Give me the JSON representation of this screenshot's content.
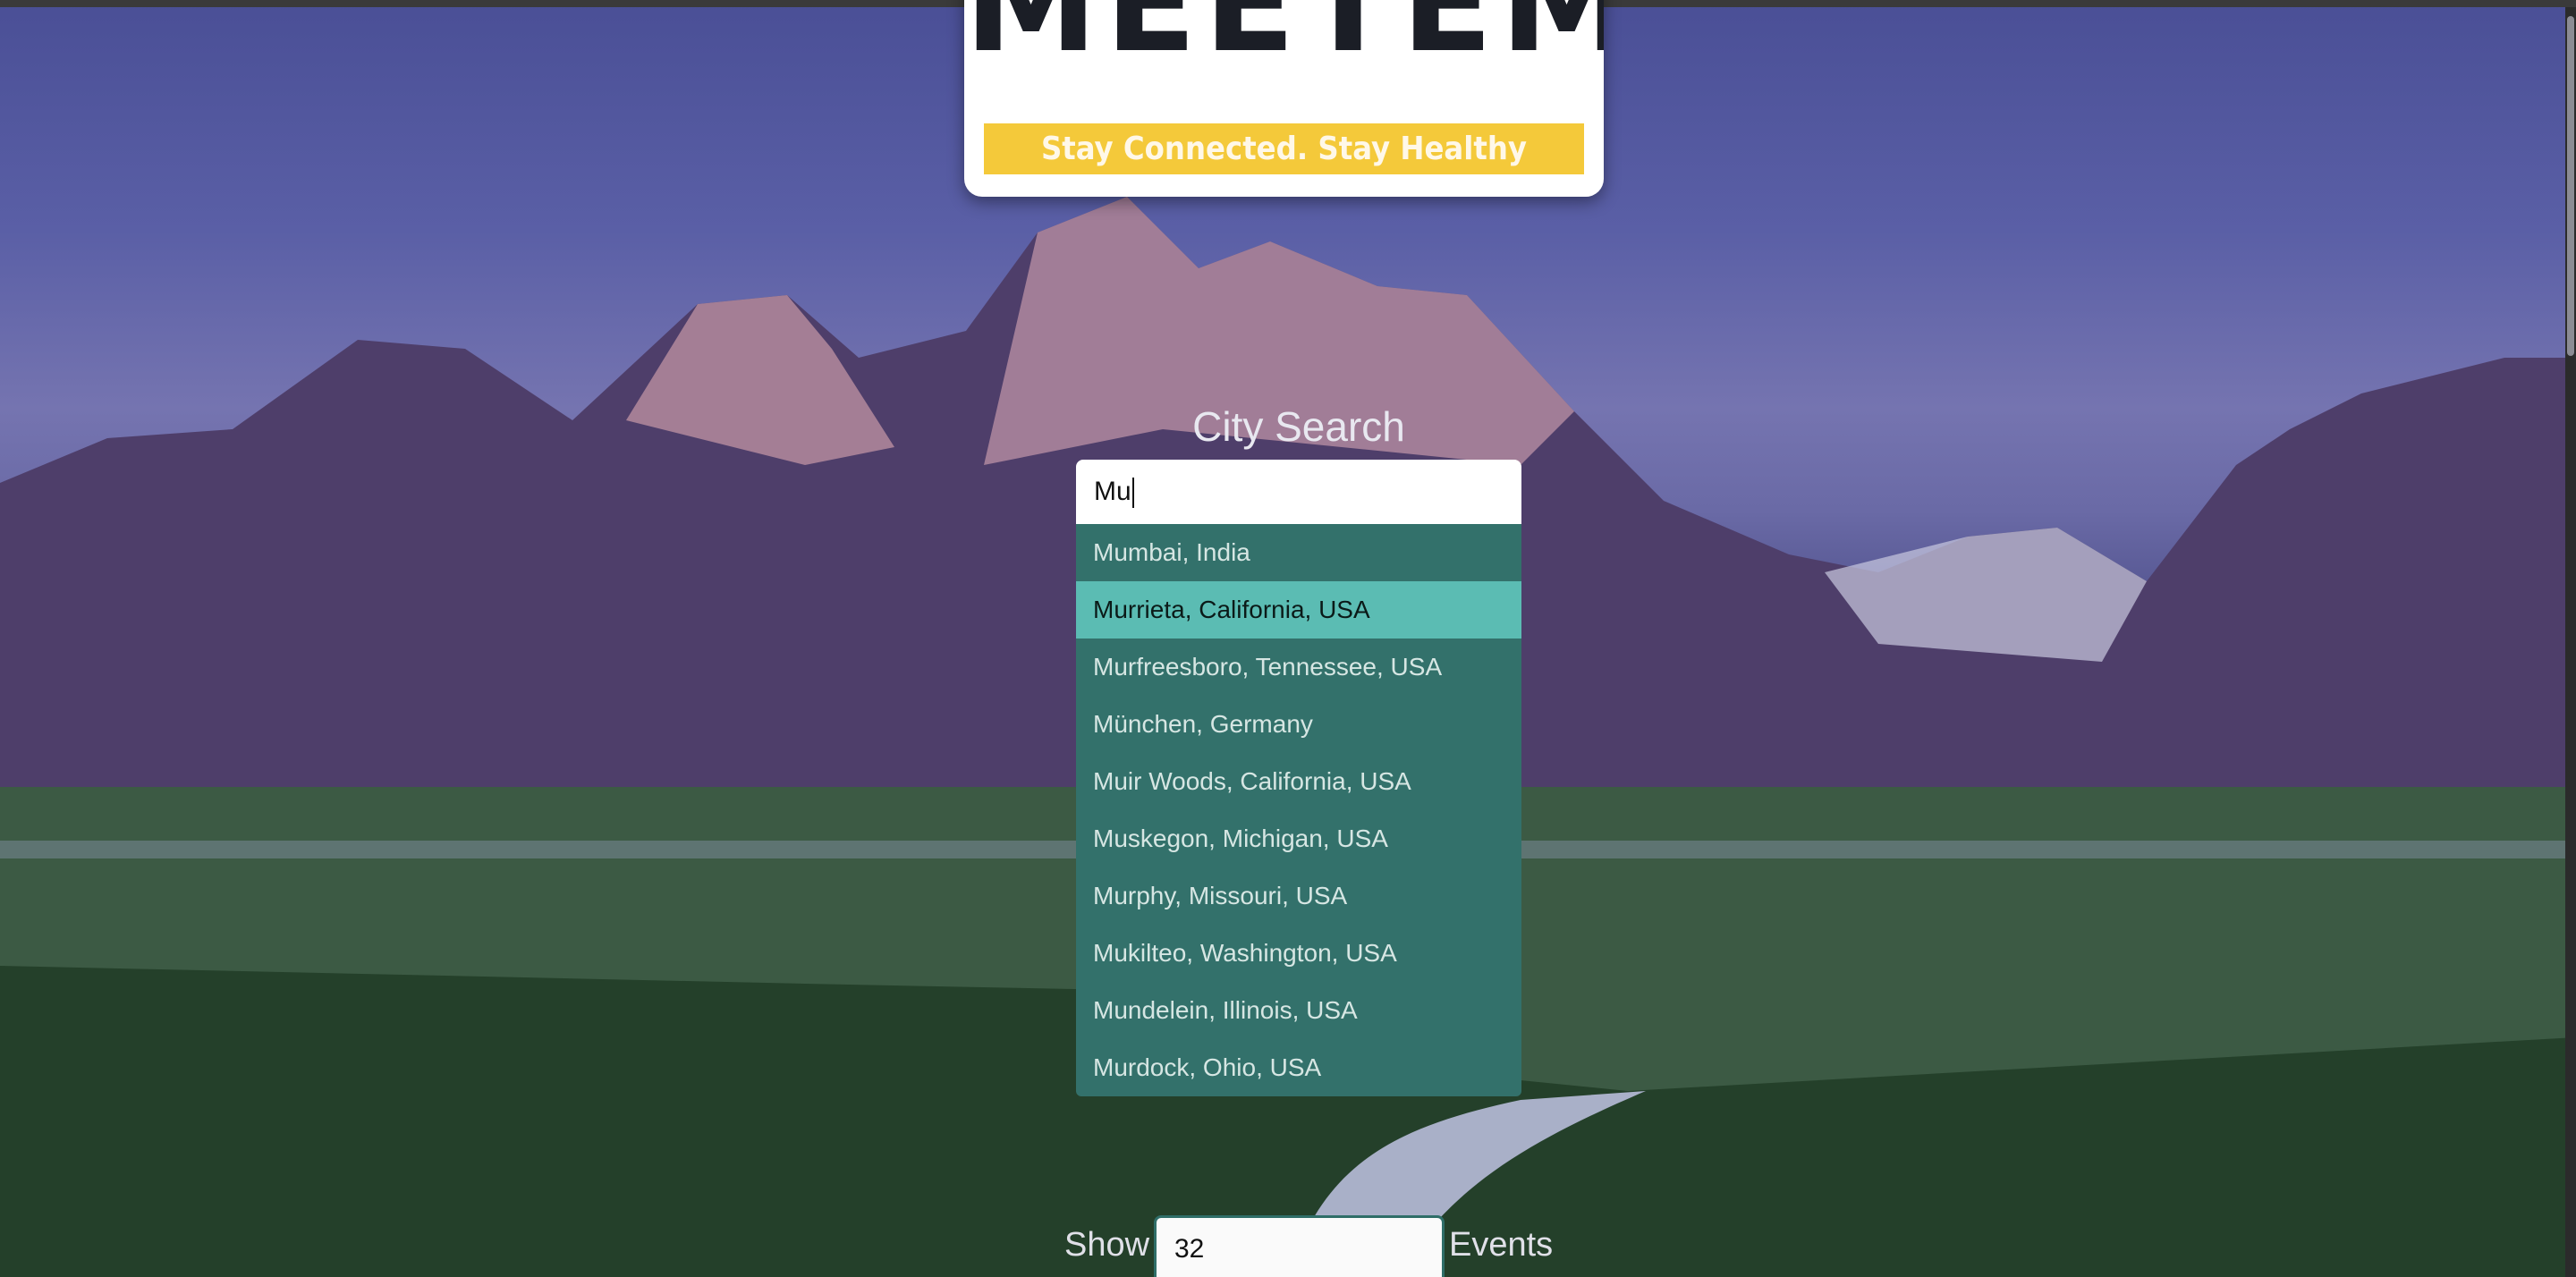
{
  "logo": {
    "wordmark": "MEETEMUP",
    "tagline": "Stay Connected. Stay Healthy"
  },
  "city_search": {
    "label": "City Search",
    "value": "Mu",
    "suggestions": [
      "Mumbai, India",
      "Murrieta, California, USA",
      "Murfreesboro, Tennessee, USA",
      "München, Germany",
      "Muir Woods, California, USA",
      "Muskegon, Michigan, USA",
      "Murphy, Missouri, USA",
      "Mukilteo, Washington, USA",
      "Mundelein, Illinois, USA",
      "Murdock, Ohio, USA"
    ],
    "highlighted_index": 1
  },
  "number_of_events": {
    "prefix": "Show",
    "value": "32",
    "suffix": "Events"
  },
  "colors": {
    "suggestion_bg": "#33716b",
    "suggestion_active": "#5bbcb3",
    "tagline_band": "#f4c93a"
  }
}
